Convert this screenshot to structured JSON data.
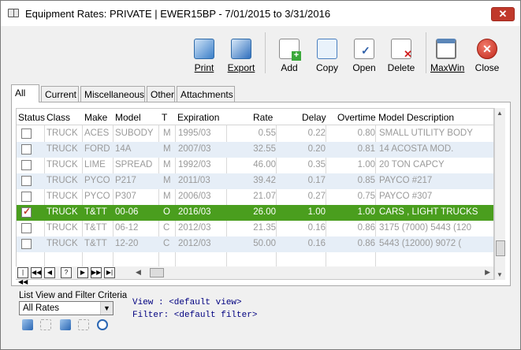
{
  "window": {
    "title": "Equipment Rates: PRIVATE | EWER15BP -  7/01/2015 to  3/31/2016",
    "close_glyph": "✕"
  },
  "toolbar": {
    "print": "Print",
    "export": "Export",
    "add": "Add",
    "copy": "Copy",
    "open": "Open",
    "delete": "Delete",
    "maxwin": "MaxWin",
    "close": "Close"
  },
  "tabs": [
    "All",
    "Current",
    "Miscellaneous",
    "Other",
    "Attachments"
  ],
  "grid": {
    "columns": [
      "Status",
      "Class",
      "Make",
      "Model",
      "T",
      "Expiration",
      "Rate",
      "Delay",
      "Overtime",
      "Model Description"
    ],
    "rows": [
      {
        "checked": false,
        "class": "TRUCK",
        "make": "ACES",
        "model": "SUBODY",
        "t": "M",
        "exp": "1995/03",
        "rate": "0.55",
        "delay": "0.22",
        "ot": "0.80",
        "desc": "SMALL UTILITY BODY"
      },
      {
        "checked": false,
        "class": "TRUCK",
        "make": "FORD",
        "model": "14A",
        "t": "M",
        "exp": "2007/03",
        "rate": "32.55",
        "delay": "0.20",
        "ot": "0.81",
        "desc": "14 ACOSTA MOD."
      },
      {
        "checked": false,
        "class": "TRUCK",
        "make": "LIME",
        "model": "SPREAD",
        "t": "M",
        "exp": "1992/03",
        "rate": "46.00",
        "delay": "0.35",
        "ot": "1.00",
        "desc": "20 TON CAPCY"
      },
      {
        "checked": false,
        "class": "TRUCK",
        "make": "PYCO",
        "model": "P217",
        "t": "M",
        "exp": "2011/03",
        "rate": "39.42",
        "delay": "0.17",
        "ot": "0.85",
        "desc": "PAYCO #217"
      },
      {
        "checked": false,
        "class": "TRUCK",
        "make": "PYCO",
        "model": "P307",
        "t": "M",
        "exp": "2006/03",
        "rate": "21.07",
        "delay": "0.27",
        "ot": "0.75",
        "desc": "PAYCO #307"
      },
      {
        "checked": true,
        "class": "TRUCK",
        "make": "T&TT",
        "model": "00-06",
        "t": "O",
        "exp": "2016/03",
        "rate": "26.00",
        "delay": "1.00",
        "ot": "1.00",
        "desc": "CARS , LIGHT TRUCKS"
      },
      {
        "checked": false,
        "class": "TRUCK",
        "make": "T&TT",
        "model": "06-12",
        "t": "C",
        "exp": "2012/03",
        "rate": "21.35",
        "delay": "0.16",
        "ot": "0.86",
        "desc": "3175 (7000)      5443 (120"
      },
      {
        "checked": false,
        "class": "TRUCK",
        "make": "T&TT",
        "model": "12-20",
        "t": "C",
        "exp": "2012/03",
        "rate": "50.00",
        "delay": "0.16",
        "ot": "0.86",
        "desc": "5443 (12000)      9072 ("
      }
    ],
    "selected_color": "#4a9e1e"
  },
  "nav_buttons": [
    "|◀◀",
    "◀◀",
    "◀",
    "?",
    "▶",
    "▶▶",
    "▶|"
  ],
  "bottom": {
    "label": "List View and Filter Criteria",
    "select_value": "All Rates",
    "view_line": "View  : <default view>",
    "filter_line": "Filter: <default filter>"
  }
}
